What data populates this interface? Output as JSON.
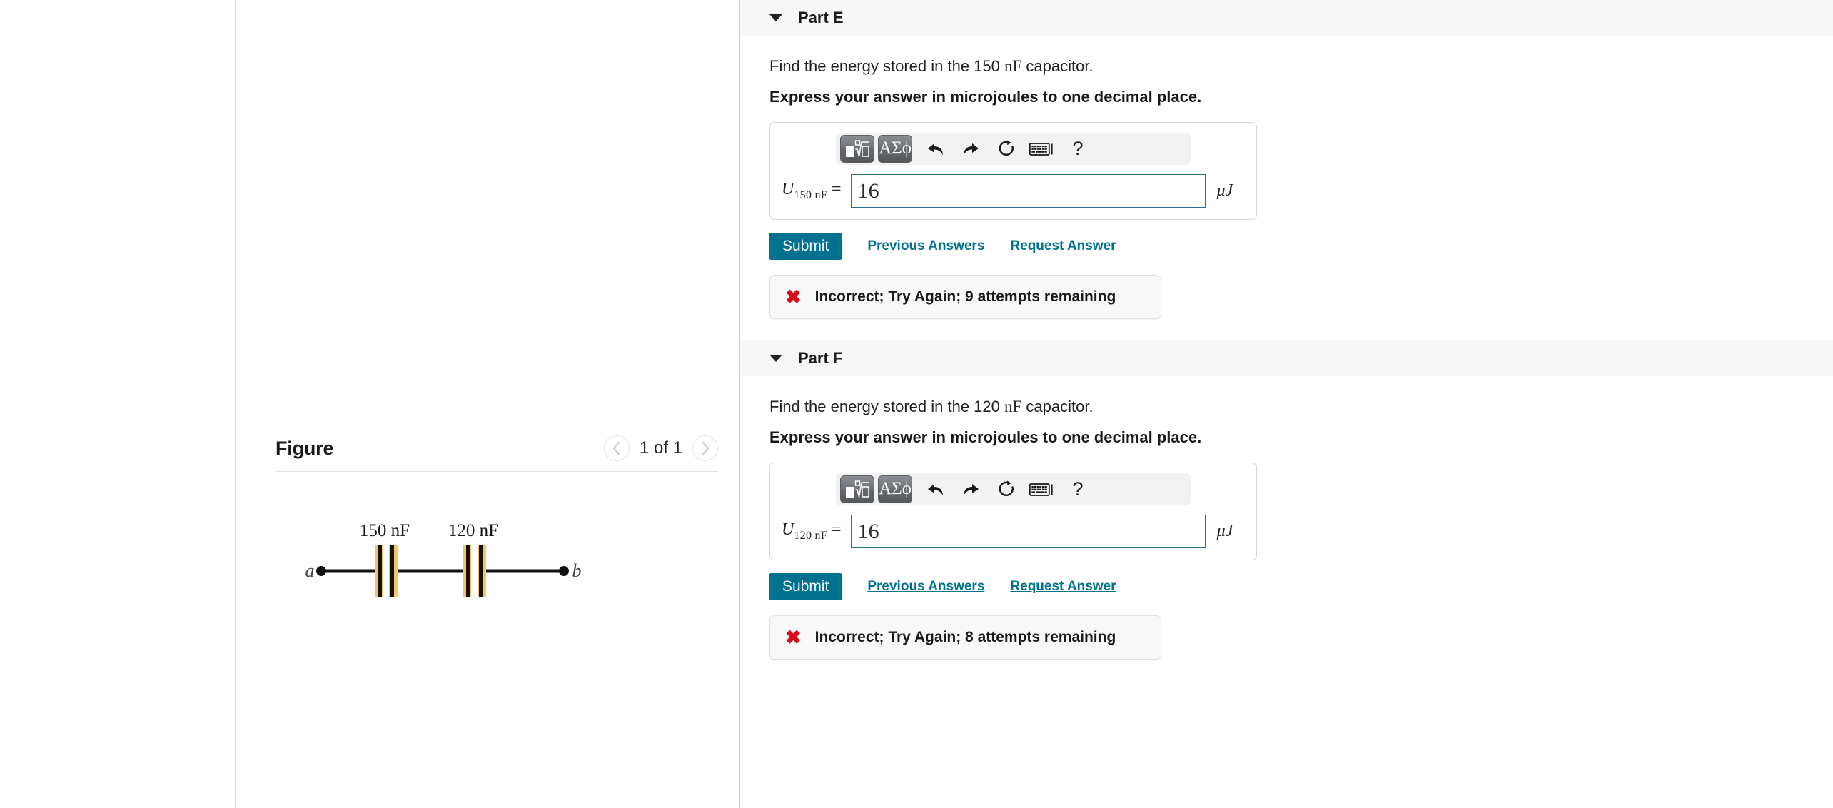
{
  "figure": {
    "title": "Figure",
    "counter": "1 of 1",
    "prev_icon": "chevron-left-icon",
    "next_icon": "chevron-right-icon",
    "circuit": {
      "node_left_label": "a",
      "node_right_label": "b",
      "capacitors": [
        {
          "label": "150 nF",
          "value": 150,
          "unit": "nF"
        },
        {
          "label": "120 nF",
          "value": 120,
          "unit": "nF"
        }
      ],
      "topology": "series",
      "wire_color": "#111111",
      "plate_highlight_color": "#f8c46a"
    }
  },
  "parts": [
    {
      "id": "part-e",
      "label": "Part E",
      "caret_icon": "caret-down-icon",
      "prompt_before": "Find the energy stored in the 150 ",
      "prompt_unit": "nF",
      "prompt_after": " capacitor.",
      "instruction": "Express your answer in microjoules to one decimal place.",
      "toolbar": {
        "math_template_icon": "math-template-icon",
        "greek_label": "ΑΣϕ",
        "undo_icon": "undo-icon",
        "redo_icon": "redo-icon",
        "reset_icon": "reset-icon",
        "keyboard_icon": "keyboard-icon",
        "help_label": "?"
      },
      "variable": "U",
      "variable_subscript": "150 nF",
      "equals": "=",
      "answer_value": "16",
      "answer_placeholder": "",
      "unit": "μJ",
      "submit_label": "Submit",
      "previous_answers_label": "Previous Answers",
      "request_answer_label": "Request Answer",
      "feedback": {
        "icon": "error-x-icon",
        "text": "Incorrect; Try Again; 9 attempts remaining",
        "status": "incorrect",
        "attempts_remaining": 9
      }
    },
    {
      "id": "part-f",
      "label": "Part F",
      "caret_icon": "caret-down-icon",
      "prompt_before": "Find the energy stored in the 120 ",
      "prompt_unit": "nF",
      "prompt_after": " capacitor.",
      "instruction": "Express your answer in microjoules to one decimal place.",
      "toolbar": {
        "math_template_icon": "math-template-icon",
        "greek_label": "ΑΣϕ",
        "undo_icon": "undo-icon",
        "redo_icon": "redo-icon",
        "reset_icon": "reset-icon",
        "keyboard_icon": "keyboard-icon",
        "help_label": "?"
      },
      "variable": "U",
      "variable_subscript": "120 nF",
      "equals": "=",
      "answer_value": "16",
      "answer_placeholder": "",
      "unit": "μJ",
      "submit_label": "Submit",
      "previous_answers_label": "Previous Answers",
      "request_answer_label": "Request Answer",
      "feedback": {
        "icon": "error-x-icon",
        "text": "Incorrect; Try Again; 8 attempts remaining",
        "status": "incorrect",
        "attempts_remaining": 8
      }
    }
  ],
  "colors": {
    "accent": "#00718f",
    "error": "#d80b1c",
    "header_band": "#f7f7f7",
    "input_border": "#2c6e8e"
  }
}
